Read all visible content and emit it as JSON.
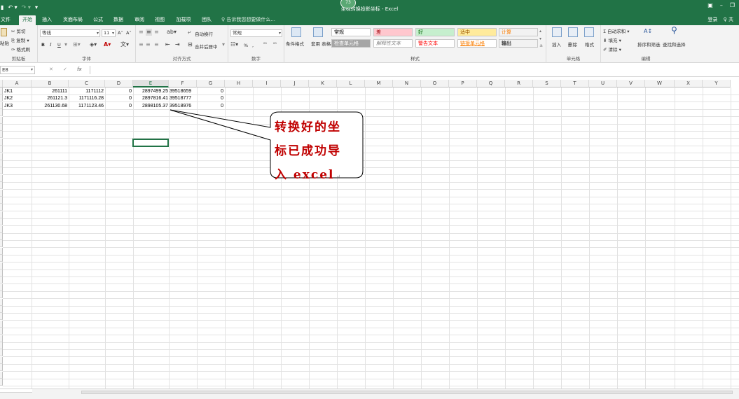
{
  "titlebar": {
    "title": "坐标转换投影坐标 - Excel",
    "badge": "73",
    "qat_save": "▮",
    "qat_undo": "↶ ▾",
    "qat_redo": "↷ ▾",
    "qat_custom": "▾"
  },
  "tabs": [
    "文件",
    "开始",
    "插入",
    "页面布局",
    "公式",
    "数据",
    "审阅",
    "视图",
    "加载项",
    "团队"
  ],
  "active_tab": "开始",
  "tell_me": "♀ 告诉我您想要做什么...",
  "login": "登录",
  "share": "♀ 共",
  "clipboard": {
    "cut": "✂ 剪切",
    "copy": "⎘ 复制 ▾",
    "format_painter": "✑ 格式刷",
    "paste": "粘贴",
    "label": "剪贴板"
  },
  "font": {
    "name": "等线",
    "size": "11",
    "grow": "A˄",
    "shrink": "A˅",
    "bold": "B",
    "italic": "I",
    "underline": "U",
    "label": "字体"
  },
  "alignment": {
    "wrap_text": "自动换行",
    "merge_center": "合并后居中",
    "label": "对齐方式"
  },
  "number": {
    "format": "常规",
    "percent": "%",
    "comma": ",",
    "label": "数字"
  },
  "styles": {
    "conditional": "条件格式",
    "table_format": "套用\n表格格式",
    "cells": [
      {
        "text": "常规",
        "bg": "#ffffff",
        "color": "#000000"
      },
      {
        "text": "差",
        "bg": "#ffc7ce",
        "color": "#9c0006"
      },
      {
        "text": "好",
        "bg": "#c6efce",
        "color": "#006100"
      },
      {
        "text": "适中",
        "bg": "#ffeb9c",
        "color": "#9c5700"
      },
      {
        "text": "计算",
        "bg": "#f2f2f2",
        "color": "#fa7d00"
      },
      {
        "text": "检查单元格",
        "bg": "#a5a5a5",
        "color": "#ffffff"
      },
      {
        "text": "解释性文本",
        "bg": "#ffffff",
        "color": "#7f7f7f"
      },
      {
        "text": "警告文本",
        "bg": "#ffffff",
        "color": "#ff0000"
      },
      {
        "text": "链接单元格",
        "bg": "#ffffff",
        "color": "#fa7d00"
      },
      {
        "text": "输出",
        "bg": "#f2f2f2",
        "color": "#3f3f3f"
      }
    ],
    "label": "样式"
  },
  "cells_group": {
    "insert": "插入",
    "delete": "删除",
    "format": "格式",
    "label": "单元格"
  },
  "editing": {
    "autosum": "Σ 自动求和 ▾",
    "fill": "⬇ 填充 ▾",
    "clear": "✐ 清除 ▾",
    "sort_filter": "排序和筛选",
    "find_select": "查找和选择",
    "label": "编辑"
  },
  "formula_bar": {
    "name_box": "E8",
    "cancel": "✕",
    "enter": "✓",
    "fx": "fx",
    "value": ""
  },
  "columns": [
    "A",
    "B",
    "C",
    "D",
    "E",
    "F",
    "G",
    "H",
    "I",
    "J",
    "K",
    "L",
    "M",
    "N",
    "O",
    "P",
    "Q",
    "R",
    "S",
    "T",
    "U",
    "V",
    "W",
    "X",
    "Y"
  ],
  "rows": [
    {
      "A": "JK1",
      "B": "261111",
      "C": "1171112",
      "D": "0",
      "E": "2897499.25",
      "F": "39518659",
      "G": "0"
    },
    {
      "A": "JK2",
      "B": "261121.3",
      "C": "1171116.28",
      "D": "0",
      "E": "2897816.41",
      "F": "39518777",
      "G": "0"
    },
    {
      "A": "JK3",
      "B": "261130.68",
      "C": "1171123.46",
      "D": "0",
      "E": "2898105.37",
      "F": "39518976",
      "G": "0"
    }
  ],
  "callout": {
    "line1": "转换好的坐",
    "line2": "标已成功导",
    "line3": "入 excel",
    "return_mark": "↵"
  },
  "colors": {
    "excel_green": "#217346",
    "callout_red": "#c00000"
  }
}
